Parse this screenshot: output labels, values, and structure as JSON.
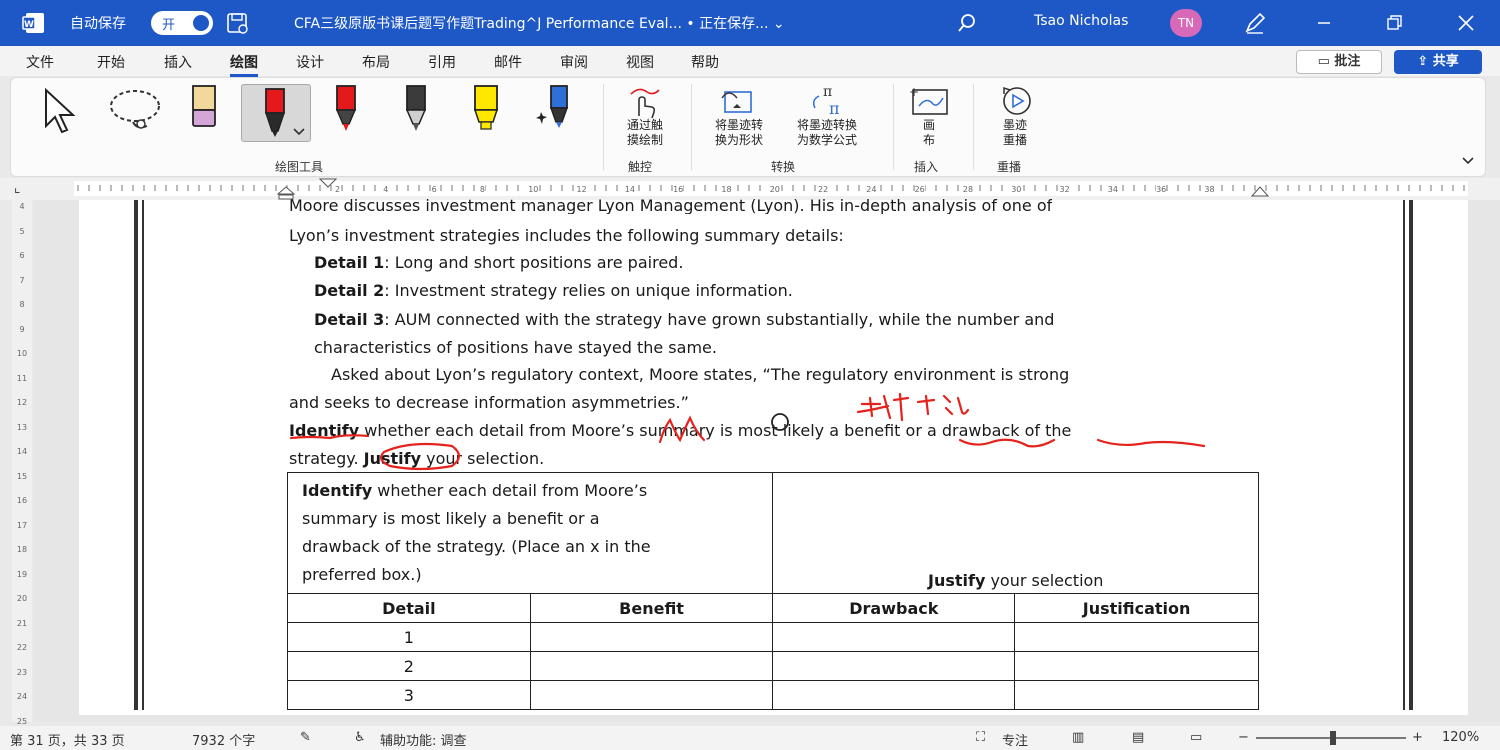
{
  "titlebar": {
    "autosave_label": "自动保存",
    "toggle_state": "开",
    "doc_title": "CFA三级原版书课后题写作题Trading^J Performance Eval... • 正在保存... ⌄",
    "user_name": "Tsao Nicholas",
    "user_initials": "TN"
  },
  "menu": {
    "items": [
      "文件",
      "开始",
      "插入",
      "绘图",
      "设计",
      "布局",
      "引用",
      "邮件",
      "审阅",
      "视图",
      "帮助"
    ],
    "active": "绘图",
    "comment_label": "批注",
    "share_label": "共享"
  },
  "ribbon": {
    "drawing_tools_label": "绘图工具",
    "touch_draw_label_1": "通过触",
    "touch_draw_label_2": "摸绘制",
    "touch_group": "触控",
    "ink_to_shape_1": "将墨迹转",
    "ink_to_shape_2": "换为形状",
    "ink_to_math_1": "将墨迹转换",
    "ink_to_math_2": "为数学公式",
    "convert_group": "转换",
    "canvas_1": "画",
    "canvas_2": "布",
    "insert_group": "插入",
    "replay_1": "墨迹",
    "replay_2": "重播",
    "replay_group": "重播",
    "pen_colors": [
      "#f2c79a",
      "#e3191c",
      "#e3191c",
      "#3b3b3b",
      "#ffe800",
      "#2f6fd6"
    ]
  },
  "ruler": {
    "labels": [
      "2",
      "4",
      "6",
      "8",
      "10",
      "12",
      "14",
      "16",
      "18",
      "20",
      "22",
      "24",
      "26",
      "28",
      "30",
      "32",
      "34",
      "36",
      "38"
    ],
    "vlabels": [
      "4",
      "5",
      "6",
      "7",
      "8",
      "9",
      "10",
      "11",
      "12",
      "13",
      "14",
      "15",
      "16",
      "17",
      "18",
      "19",
      "20",
      "21",
      "22",
      "23",
      "24",
      "25"
    ]
  },
  "doc": {
    "line0": "Moore discusses investment manager Lyon Management (Lyon). His in-depth analysis of one of",
    "line1": "Lyon’s investment strategies includes the following summary details:",
    "detail1_label": "Detail 1",
    "detail1_text": ": Long and short positions are paired.",
    "detail2_label": "Detail 2",
    "detail2_text": ": Investment strategy relies on unique information.",
    "detail3_label": "Detail 3",
    "detail3_text": ": AUM connected with the strategy have grown substantially, while the number and",
    "detail3_cont": "characteristics of positions have stayed the same.",
    "para2_a": "Asked about Lyon’s regulatory context, Moore states, “The regulatory environment is strong",
    "para2_b": "and seeks to decrease information asymmetries.”",
    "q_identify": "Identify",
    "q_text_a": " whether each detail from Moore’s summary is most likely a benefit or a drawback of the",
    "q_text_b1": "strategy. ",
    "q_justify": "Justify",
    "q_text_b2": " your selection."
  },
  "table": {
    "hdr_identify": "Identify",
    "hdr_line1": " whether each detail from Moore’s",
    "hdr_line2": "summary is most likely a benefit or a",
    "hdr_line3": "drawback of the strategy. (Place an x in the",
    "hdr_line4": "preferred box.)",
    "hdr_justify": "Justify",
    "hdr_justify_rest": " your selection",
    "columns": [
      "Detail",
      "Benefit",
      "Drawback",
      "Justification"
    ],
    "rows": [
      "1",
      "2",
      "3"
    ]
  },
  "ink_colors": {
    "red": "#e5231d"
  },
  "status": {
    "page": "第 31 页，共 33 页",
    "words": "7932 个字",
    "accessibility": "辅助功能: 调查",
    "focus": "专注",
    "zoom": "120%"
  }
}
